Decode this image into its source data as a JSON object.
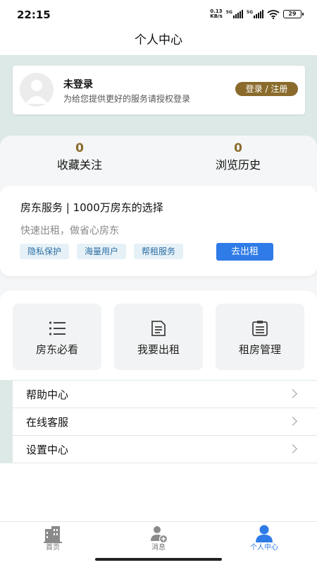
{
  "status_bar": {
    "time": "22:15",
    "net_speed_value": "0.13",
    "net_speed_unit": "KB/s",
    "sig1": "5G",
    "sig2": "5G",
    "battery": "29"
  },
  "header": {
    "title": "个人中心"
  },
  "user": {
    "name": "未登录",
    "desc": "为给您提供更好的服务请授权登录",
    "login_label": "登录 / 注册"
  },
  "stats": [
    {
      "value": "0",
      "label": "收藏关注"
    },
    {
      "value": "0",
      "label": "浏览历史"
    }
  ],
  "landlord": {
    "title": "房东服务 | 1000万房东的选择",
    "subtitle": "快速出租，做省心房东",
    "tags": [
      "隐私保护",
      "海量用户",
      "帮租服务"
    ],
    "button": "去出租"
  },
  "grid": [
    {
      "label": "房东必看",
      "icon": "list-icon"
    },
    {
      "label": "我要出租",
      "icon": "document-icon"
    },
    {
      "label": "租房管理",
      "icon": "clipboard-icon"
    }
  ],
  "menu": [
    {
      "label": "帮助中心"
    },
    {
      "label": "在线客服"
    },
    {
      "label": "设置中心"
    }
  ],
  "nav": [
    {
      "label": "首页",
      "icon": "building-icon"
    },
    {
      "label": "消息",
      "icon": "user-add-icon"
    },
    {
      "label": "个人中心",
      "icon": "person-icon"
    }
  ],
  "colors": {
    "accent_gold": "#8a6b2c",
    "accent_blue": "#2f7be8",
    "teal_bg": "#dde9e7"
  }
}
